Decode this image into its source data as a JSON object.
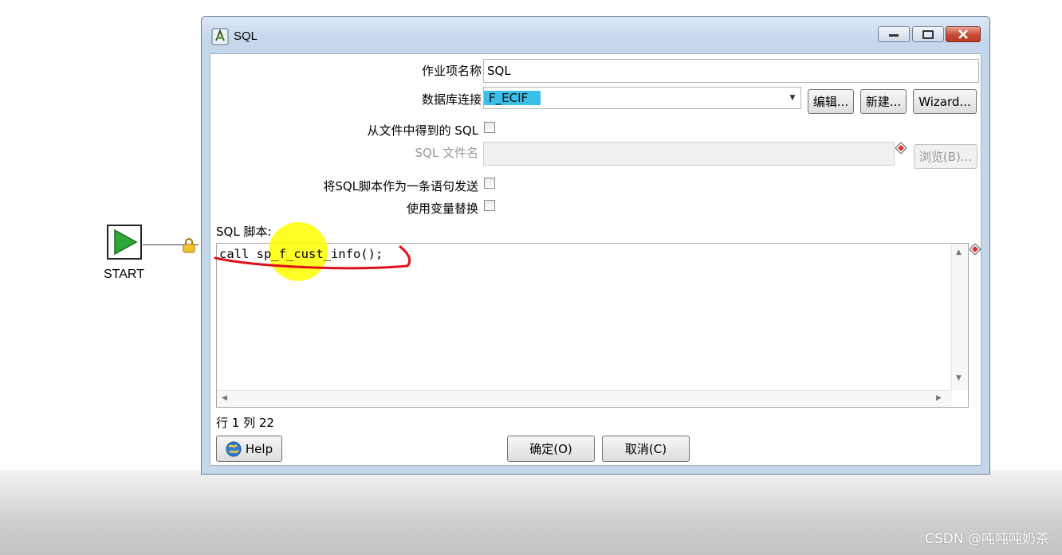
{
  "canvas": {
    "start_label": "START"
  },
  "window": {
    "title": "SQL"
  },
  "form": {
    "job_name_label": "作业项名称",
    "job_name_value": "SQL",
    "db_connection_label": "数据库连接",
    "db_connection_value": "F_ECIF",
    "edit_button": "编辑...",
    "new_button": "新建...",
    "wizard_button": "Wizard...",
    "sql_from_file_label": "从文件中得到的 SQL",
    "sql_filename_label": "SQL 文件名",
    "sql_filename_value": "",
    "browse_button": "浏览(B)...",
    "send_as_single_label": "将SQL脚本作为一条语句发送",
    "use_variable_label": "使用变量替换",
    "sql_script_label": "SQL 脚本:",
    "sql_script": "call sp_f_cust_info();"
  },
  "status": {
    "position": "行 1 列 22"
  },
  "footer": {
    "help_button": "Help",
    "ok_button": "确定(O)",
    "cancel_button": "取消(C)"
  },
  "watermark": "CSDN @吨吨吨奶茶",
  "colors": {
    "highlight": "#39c0ea",
    "annotation": "#e0101a",
    "cursor_highlight": "#ffff00",
    "start_green": "#2ea836"
  }
}
